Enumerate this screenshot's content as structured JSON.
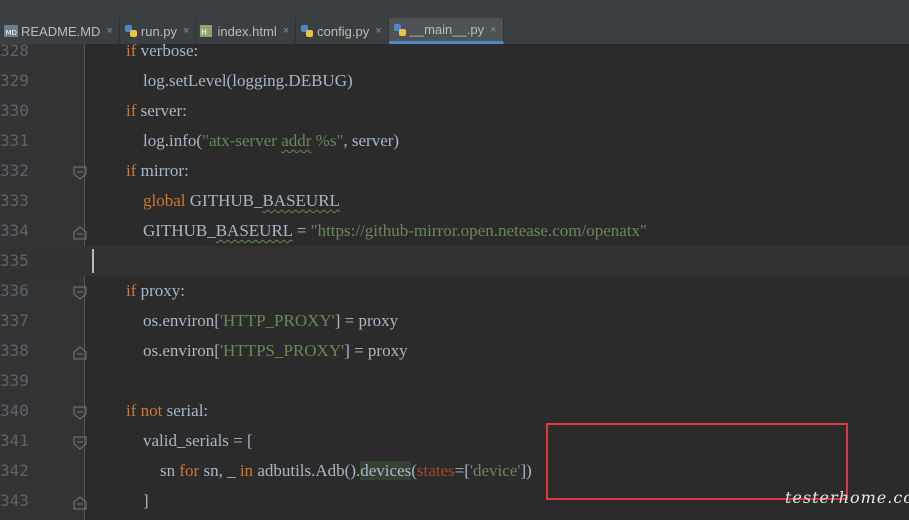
{
  "tabs": [
    {
      "label": "README.MD",
      "icon": "markdown-file-icon",
      "active": false
    },
    {
      "label": "run.py",
      "icon": "python-file-icon",
      "active": false
    },
    {
      "label": "index.html",
      "icon": "html-file-icon",
      "active": false
    },
    {
      "label": "config.py",
      "icon": "python-file-icon",
      "active": false
    },
    {
      "label": "__main__.py",
      "icon": "python-file-icon",
      "active": true
    }
  ],
  "close_glyph": "×",
  "lines": [
    {
      "num": "328",
      "fold": "none",
      "html": "        <span class=\"kw\">if</span> verbose:"
    },
    {
      "num": "329",
      "fold": "none",
      "html": "            log.setLevel(logging.DEBUG)"
    },
    {
      "num": "330",
      "fold": "none",
      "html": "        <span class=\"kw\">if</span> server:"
    },
    {
      "num": "331",
      "fold": "none",
      "html": "            log.info(<span class=\"str\">\"atx-server <span class=\"wavy\">addr</span> %s\"</span>, server)"
    },
    {
      "num": "332",
      "fold": "open",
      "html": "        <span class=\"kw\">if</span> mirror:"
    },
    {
      "num": "333",
      "fold": "none",
      "html": "            <span class=\"kw\">global</span> GITHUB_<span class=\"wavy\">BASEURL</span>"
    },
    {
      "num": "334",
      "fold": "close",
      "html": "            GITHUB_<span class=\"wavy\">BASEURL</span> = <span class=\"str\">\"https://github-mirror.open.netease.com/openatx\"</span>"
    },
    {
      "num": "335",
      "fold": "none",
      "html": "",
      "caret": true
    },
    {
      "num": "336",
      "fold": "open",
      "html": "        <span class=\"kw\">if</span> proxy:"
    },
    {
      "num": "337",
      "fold": "none",
      "html": "            os.environ[<span class=\"str\">'HTTP_PROXY'</span>] = proxy"
    },
    {
      "num": "338",
      "fold": "close",
      "html": "            os.environ[<span class=\"str\">'HTTPS_PROXY'</span>] = proxy"
    },
    {
      "num": "339",
      "fold": "none",
      "html": ""
    },
    {
      "num": "340",
      "fold": "open",
      "html": "        <span class=\"kw\">if not</span> serial:"
    },
    {
      "num": "341",
      "fold": "open",
      "html": "            valid_serials = ["
    },
    {
      "num": "342",
      "fold": "none",
      "html": "                sn <span class=\"kw\">for</span> sn, _ <span class=\"kw\">in</span> adbutils.Adb().<span class=\"hl\">devices</span>(<span class=\"param\">states</span>=[<span class=\"str\">'device'</span>])"
    },
    {
      "num": "343",
      "fold": "close",
      "html": "            ]"
    }
  ],
  "watermark": "testerhome.com",
  "colors": {
    "keyword": "#cc7832",
    "string": "#6a8759",
    "param": "#aa4926",
    "highlight_box": "#e0383e"
  }
}
